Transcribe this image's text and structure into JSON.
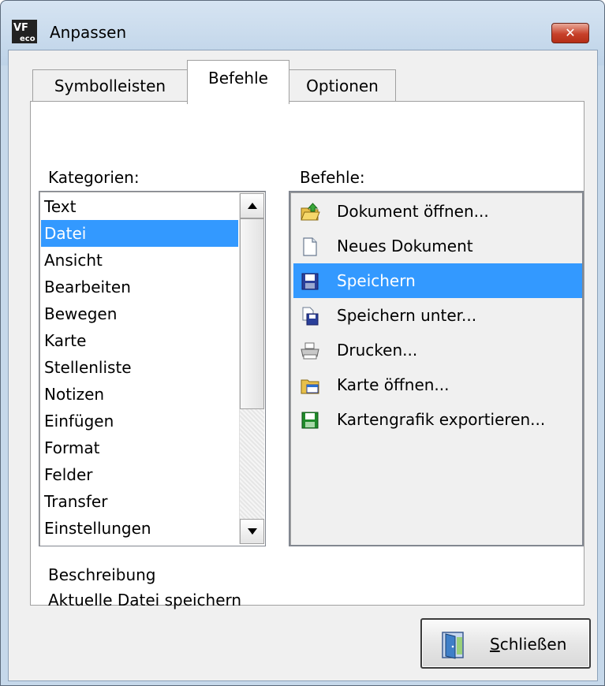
{
  "window": {
    "title": "Anpassen",
    "close_glyph": "✕"
  },
  "tabs": [
    {
      "label": "Symbolleisten"
    },
    {
      "label": "Befehle"
    },
    {
      "label": "Optionen"
    }
  ],
  "categories": {
    "label": "Kategorien:",
    "items": [
      "Text",
      "Datei",
      "Ansicht",
      "Bearbeiten",
      "Bewegen",
      "Karte",
      "Stellenliste",
      "Notizen",
      "Einfügen",
      "Format",
      "Felder",
      "Transfer",
      "Einstellungen"
    ],
    "selected": "Datei"
  },
  "commands": {
    "label": "Befehle:",
    "items": [
      {
        "label": "Dokument öffnen...",
        "icon": "open-folder-icon"
      },
      {
        "label": "Neues Dokument",
        "icon": "new-document-icon"
      },
      {
        "label": "Speichern",
        "icon": "save-icon"
      },
      {
        "label": "Speichern unter...",
        "icon": "save-as-icon"
      },
      {
        "label": "Drucken...",
        "icon": "printer-icon"
      },
      {
        "label": "Karte öffnen...",
        "icon": "open-map-icon"
      },
      {
        "label": "Kartengrafik exportieren...",
        "icon": "export-save-icon"
      }
    ],
    "selected": "Speichern"
  },
  "description": {
    "title": "Beschreibung",
    "text": "Aktuelle Datei speichern"
  },
  "buttons": {
    "close_label": "Schließen"
  },
  "colors": {
    "selection": "#3399ff",
    "title_close": "#c7412a"
  }
}
